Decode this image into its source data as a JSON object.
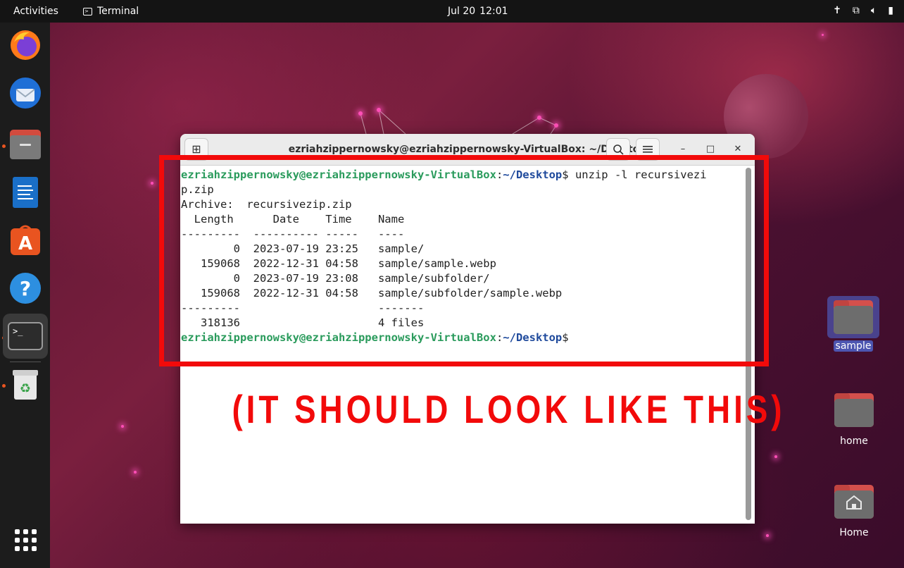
{
  "topbar": {
    "activities": "Activities",
    "app_name": "Terminal",
    "date": "Jul 20",
    "time": "12:01"
  },
  "window": {
    "title": "ezriahzippernowsky@ezriahzippernowsky-VirtualBox: ~/Desktop",
    "icons": [
      "new-tab-icon",
      "search-icon",
      "menu-icon",
      "minimize-icon",
      "maximize-icon",
      "close-icon"
    ]
  },
  "terminal": {
    "prompt_user": "ezriahzippernowsky@ezriahzippernowsky-VirtualBox",
    "prompt_sep": ":",
    "prompt_path": "~/Desktop",
    "prompt_end": "$",
    "command_part1": " unzip -l recursivezi",
    "command_part2": "p.zip",
    "archive_line": "Archive:  recursivezip.zip",
    "header": "  Length      Date    Time    Name",
    "divider": "---------  ---------- -----   ----",
    "rows": [
      "        0  2023-07-19 23:25   sample/",
      "   159068  2022-12-31 04:58   sample/sample.webp",
      "        0  2023-07-19 23:08   sample/subfolder/",
      "   159068  2022-12-31 04:58   sample/subfolder/sample.webp"
    ],
    "footer_divider": "---------                     -------",
    "total_line": "   318136                     4 files"
  },
  "annotation": {
    "text": "(IT SHOULD LOOK LIKE THIS)",
    "color": "#f20a0a"
  },
  "desktop": {
    "icons": [
      {
        "label": "sample"
      },
      {
        "label": "home"
      },
      {
        "label": "Home"
      }
    ]
  },
  "dock": {
    "items": [
      "firefox-icon",
      "thunderbird-icon",
      "files-icon",
      "writer-icon",
      "app-center-icon",
      "help-icon",
      "terminal-icon",
      "trash-icon",
      "show-apps-icon"
    ]
  },
  "colors": {
    "accent": "#e95420",
    "prompt_user": "#2a9b5c",
    "prompt_path": "#1f4a9c"
  }
}
